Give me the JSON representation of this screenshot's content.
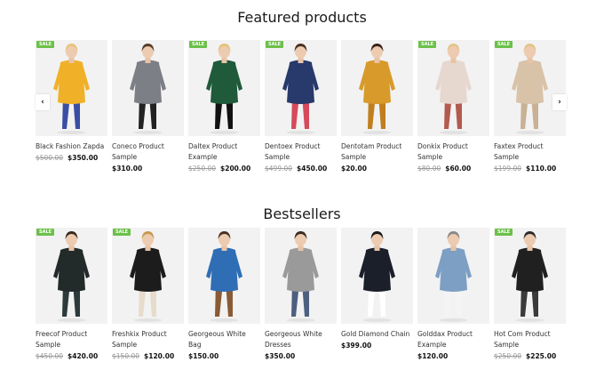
{
  "featured": {
    "title": "Featured products",
    "prev_arrow": "‹",
    "next_arrow": "›",
    "products": [
      {
        "name": "Black Fashion Zapda",
        "name_line2": "",
        "old_price": "$500.00",
        "price": "$350.00",
        "sale": "SALE",
        "outfit": "#f0b129",
        "accent": "#3a4fa3",
        "hair": "#e9c47a"
      },
      {
        "name": "Coneco Product Sample",
        "name_line2": "",
        "old_price": "",
        "price": "$310.00",
        "sale": "",
        "outfit": "#7d7f86",
        "accent": "#222222",
        "hair": "#5a3b2a"
      },
      {
        "name": "Daltex Product Example",
        "name_line2": "",
        "old_price": "$250.00",
        "price": "$200.00",
        "sale": "SALE",
        "outfit": "#1f5a3a",
        "accent": "#111111",
        "hair": "#e3c27b"
      },
      {
        "name": "Dentoex Product",
        "name_line2": "Sample",
        "old_price": "$499.00",
        "price": "$450.00",
        "sale": "SALE",
        "outfit": "#28396b",
        "accent": "#d64a5b",
        "hair": "#4b2e22"
      },
      {
        "name": "Dentotam Product",
        "name_line2": "Sample",
        "old_price": "",
        "price": "$20.00",
        "sale": "",
        "outfit": "#d89a2a",
        "accent": "#c07f1f",
        "hair": "#3a2318"
      },
      {
        "name": "Donkix Product Sample",
        "name_line2": "",
        "old_price": "$80.00",
        "price": "$60.00",
        "sale": "SALE",
        "outfit": "#e6d8cf",
        "accent": "#b35a4f",
        "hair": "#e4c48a"
      },
      {
        "name": "Faxtex Product Sample",
        "name_line2": "",
        "old_price": "$199.00",
        "price": "$110.00",
        "sale": "SALE",
        "outfit": "#d8c2a8",
        "accent": "#c8b194",
        "hair": "#e4c48a"
      }
    ]
  },
  "bestsellers": {
    "title": "Bestsellers",
    "products": [
      {
        "name": "Freecof Product Sample",
        "name_line2": "",
        "old_price": "$450.00",
        "price": "$420.00",
        "sale": "SALE",
        "outfit": "#222a2a",
        "accent": "#2c3a3a",
        "hair": "#3a2a1f"
      },
      {
        "name": "Freshkix Product",
        "name_line2": "Sample",
        "old_price": "$150.00",
        "price": "$120.00",
        "sale": "SALE",
        "outfit": "#1c1c1c",
        "accent": "#e7dccb",
        "hair": "#c79a52"
      },
      {
        "name": "Georgeous White Bag",
        "name_line2": "",
        "old_price": "",
        "price": "$150.00",
        "sale": "",
        "outfit": "#2f6db5",
        "accent": "#8a5a34",
        "hair": "#4a3020"
      },
      {
        "name": "Georgeous White",
        "name_line2": "Dresses",
        "old_price": "",
        "price": "$350.00",
        "sale": "",
        "outfit": "#9a9a9a",
        "accent": "#4d6080",
        "hair": "#3b2a1f"
      },
      {
        "name": "Gold Diamond Chain",
        "name_line2": "",
        "old_price": "",
        "price": "$399.00",
        "sale": "",
        "outfit": "#1b1f2a",
        "accent": "#ffffff",
        "hair": "#1a1a1a"
      },
      {
        "name": "Golddax Product",
        "name_line2": "Example",
        "old_price": "",
        "price": "$120.00",
        "sale": "",
        "outfit": "#7d9fc4",
        "accent": "#f4f4f4",
        "hair": "#888888"
      },
      {
        "name": "Hot Com Product",
        "name_line2": "Sample",
        "old_price": "$250.00",
        "price": "$225.00",
        "sale": "SALE",
        "outfit": "#202020",
        "accent": "#3a3a3a",
        "hair": "#2a2a2a"
      }
    ]
  }
}
